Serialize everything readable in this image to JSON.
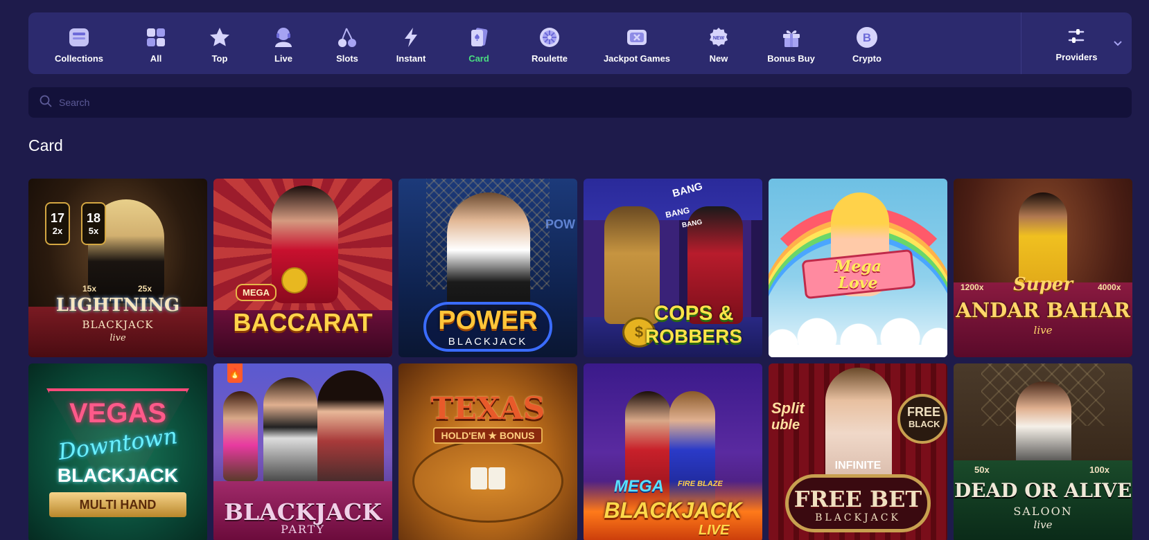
{
  "nav": {
    "items": [
      {
        "label": "Collections",
        "icon": "collections-icon"
      },
      {
        "label": "All",
        "icon": "grid-icon"
      },
      {
        "label": "Top",
        "icon": "star-icon"
      },
      {
        "label": "Live",
        "icon": "live-dealer-icon"
      },
      {
        "label": "Slots",
        "icon": "cherry-icon"
      },
      {
        "label": "Instant",
        "icon": "lightning-icon"
      },
      {
        "label": "Card",
        "icon": "card-icon"
      },
      {
        "label": "Roulette",
        "icon": "roulette-icon"
      },
      {
        "label": "Jackpot Games",
        "icon": "jackpot-icon"
      },
      {
        "label": "New",
        "icon": "new-badge-icon"
      },
      {
        "label": "Bonus Buy",
        "icon": "gift-icon"
      },
      {
        "label": "Crypto",
        "icon": "bitcoin-icon"
      }
    ],
    "active": "Card",
    "providers_label": "Providers"
  },
  "search": {
    "placeholder": "Search"
  },
  "section": {
    "title": "Card"
  },
  "colors": {
    "background": "#1e1b4b",
    "navbar": "#2c2a6e",
    "active": "#4ade80",
    "search": "#13113a"
  },
  "games": [
    {
      "name": "lightning-blackjack",
      "title": "LIGHTNING",
      "sub": "BLACKJACK",
      "tag": "live",
      "chips": [
        "17",
        "18",
        "2x",
        "5x",
        "15x",
        "25x"
      ]
    },
    {
      "name": "mega-baccarat",
      "title": "BACCARAT",
      "badge": "MEGA"
    },
    {
      "name": "power-blackjack",
      "title": "POWER",
      "sub": "BLACKJACK",
      "side": "POW"
    },
    {
      "name": "cops-and-robbers",
      "title": "COPS &",
      "sub": "ROBBERS",
      "sounds": [
        "BANG",
        "BANG",
        "BANG"
      ],
      "coin": "$"
    },
    {
      "name": "mega-love",
      "title": "Mega",
      "sub": "Love"
    },
    {
      "name": "super-andar-bahar",
      "title": "ANDAR BAHAR",
      "top": "Super",
      "tag": "live",
      "mult_left": "1200x",
      "mult_right": "4000x"
    },
    {
      "name": "vegas-downtown-blackjack",
      "title": "VEGAS",
      "script": "Downtown",
      "sub": "BLACKJACK",
      "ribbon": "MULTI HAND"
    },
    {
      "name": "blackjack-party",
      "title": "BLACKJACK",
      "sub": "PARTY"
    },
    {
      "name": "texas-holdem-bonus",
      "title": "TEXAS",
      "sub": "HOLD'EM ★ BONUS"
    },
    {
      "name": "mega-fire-blaze-blackjack",
      "top": "MEGA",
      "top2": "FIRE BLAZE",
      "title": "BLACKJACK",
      "sub": "LIVE"
    },
    {
      "name": "infinite-free-bet-blackjack",
      "top": "INFINITE",
      "title": "FREE BET",
      "sub": "BLACKJACK",
      "side": "FREE",
      "side2": "BLACK",
      "left1": "Split",
      "left2": "uble"
    },
    {
      "name": "dead-or-alive-saloon",
      "title": "DEAD OR ALIVE",
      "sub": "SALOON",
      "tag": "live",
      "mult_left": "50x",
      "mult_right": "100x"
    }
  ]
}
